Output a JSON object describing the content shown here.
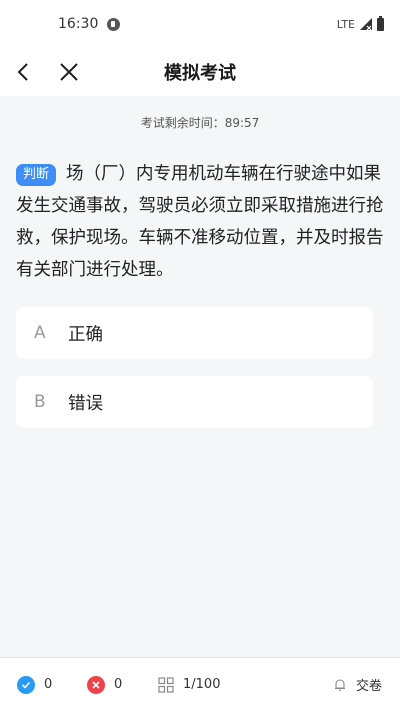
{
  "status_bar": {
    "time": "16:30",
    "network": "LTE"
  },
  "header": {
    "title": "模拟考试"
  },
  "timer": {
    "label": "考试剩余时间：",
    "value": "89:57"
  },
  "question": {
    "tag": "判断",
    "text": "场（厂）内专用机动车辆在行驶途中如果发生交通事故，驾驶员必须立即采取措施进行抢救，保护现场。车辆不准移动位置，并及时报告有关部门进行处理。"
  },
  "options": [
    {
      "letter": "A",
      "text": "正确"
    },
    {
      "letter": "B",
      "text": "错误"
    }
  ],
  "bottom_bar": {
    "correct_count": "0",
    "wrong_count": "0",
    "progress": "1/100",
    "submit_label": "交卷"
  },
  "colors": {
    "accent": "#3d8df5",
    "correct": "#2a9bf5",
    "wrong": "#f0424a",
    "background": "#f5f6f8"
  },
  "icons": {
    "back": "chevron-left-icon",
    "close": "close-icon",
    "correct": "check-circle-icon",
    "wrong": "x-circle-icon",
    "progress": "grid-icon",
    "submit": "bell-icon"
  }
}
